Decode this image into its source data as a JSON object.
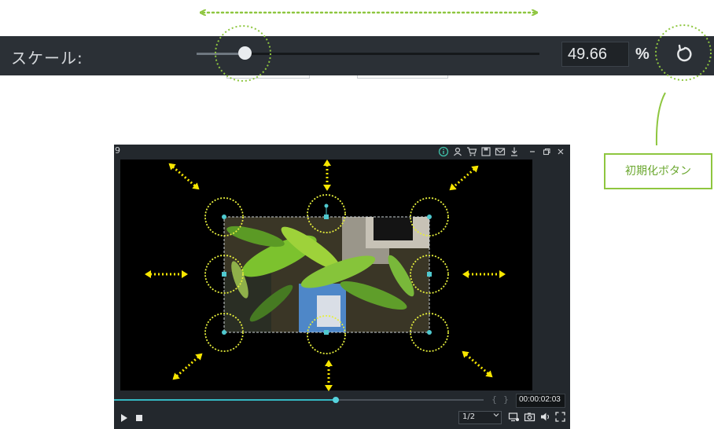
{
  "scale_panel": {
    "label": "スケール:",
    "value": "49.66",
    "unit": "%",
    "slider_fraction": 0.14,
    "icons": {
      "reset": "reset-icon"
    }
  },
  "callout": {
    "label": "初期化ボタン"
  },
  "preview": {
    "window_number": "9",
    "titlebar_icons": [
      "info-icon",
      "user-icon",
      "cart-icon",
      "save-icon",
      "mail-icon",
      "download-icon",
      "minimize-icon",
      "restore-icon",
      "close-icon"
    ],
    "timeline_fraction": 0.6,
    "timecode": "00:00:02:03",
    "quality": "1/2",
    "braces": {
      "left": "{",
      "right": "}"
    },
    "controls": [
      "play-icon",
      "stop-icon",
      "display-icon",
      "snapshot-icon",
      "volume-icon",
      "fullscreen-icon"
    ]
  },
  "colors": {
    "annotation_green": "#8ec63f",
    "annotation_yellow": "#f7e600",
    "handle_teal": "#4fc9cf",
    "toolbar_bg": "#2b3036"
  }
}
